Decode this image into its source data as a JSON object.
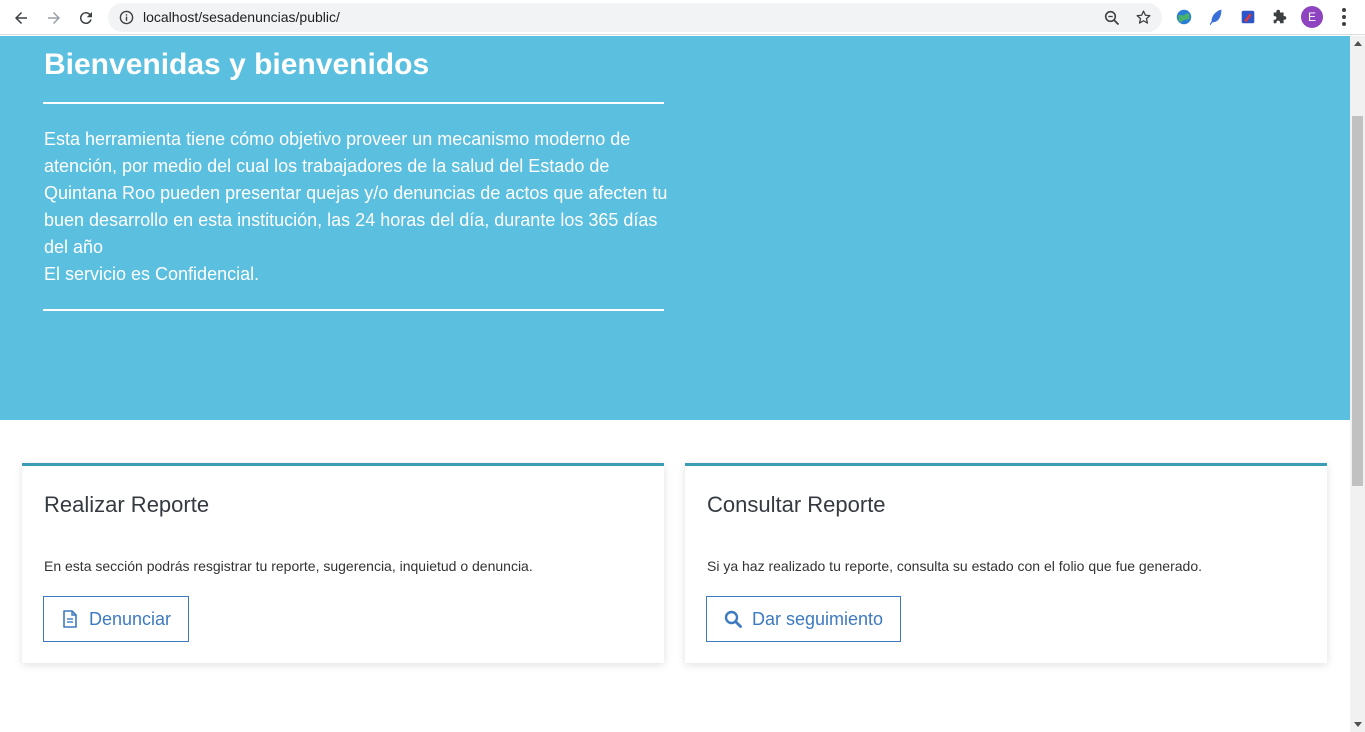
{
  "browser": {
    "url": "localhost/sesadenuncias/public/",
    "profile_initial": "E",
    "profile_color": "#8e44c0"
  },
  "hero": {
    "title": "Bienvenidas y bienvenidos",
    "intro_lines": [
      "Esta herramienta tiene cómo objetivo proveer un mecanismo moderno de",
      "atención, por medio del cual los trabajadores de la salud del Estado de",
      "Quintana Roo pueden presentar quejas y/o denuncias de actos que afecten tu",
      "buen desarrollo en esta institución, las 24 horas del día, durante los 365 días",
      "del año",
      "El servicio es Confidencial."
    ],
    "background_color": "#5bbfdf"
  },
  "cards": {
    "report": {
      "title": "Realizar Reporte",
      "description": "En esta sección podrás resgistrar tu reporte, sugerencia, inquietud o denuncia.",
      "button_label": "Denunciar",
      "button_icon": "document-icon"
    },
    "consult": {
      "title": "Consultar Reporte",
      "description": "Si ya haz realizado tu reporte, consulta su estado con el folio que fue generado.",
      "button_label": "Dar seguimiento",
      "button_icon": "search-icon"
    },
    "accent_color": "#3c9bb5",
    "button_color": "#3d7ac0"
  }
}
